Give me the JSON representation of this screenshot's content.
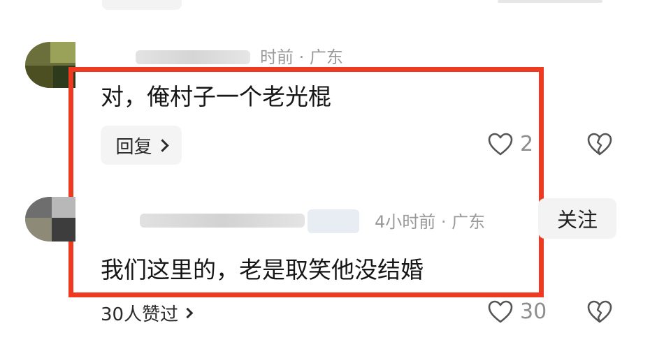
{
  "thread": {
    "comment_1": {
      "location_text": "时前 · 广东",
      "body": "对，俺村子一个老光棍",
      "reply_label": "回复",
      "likes": "2"
    },
    "comment_2": {
      "meta_text": "4小时前 · 广东",
      "body": "我们这里的，老是取笑他没结婚",
      "follow_label": "关注",
      "liked_by_label": "30人赞过",
      "likes": "30"
    }
  },
  "colors": {
    "highlight": "#ef3a22",
    "meta_gray": "#9a9a9a"
  },
  "icons": {
    "like": "heart-outline-icon",
    "dislike": "broken-heart-icon",
    "chevron": "chevron-right-icon"
  }
}
